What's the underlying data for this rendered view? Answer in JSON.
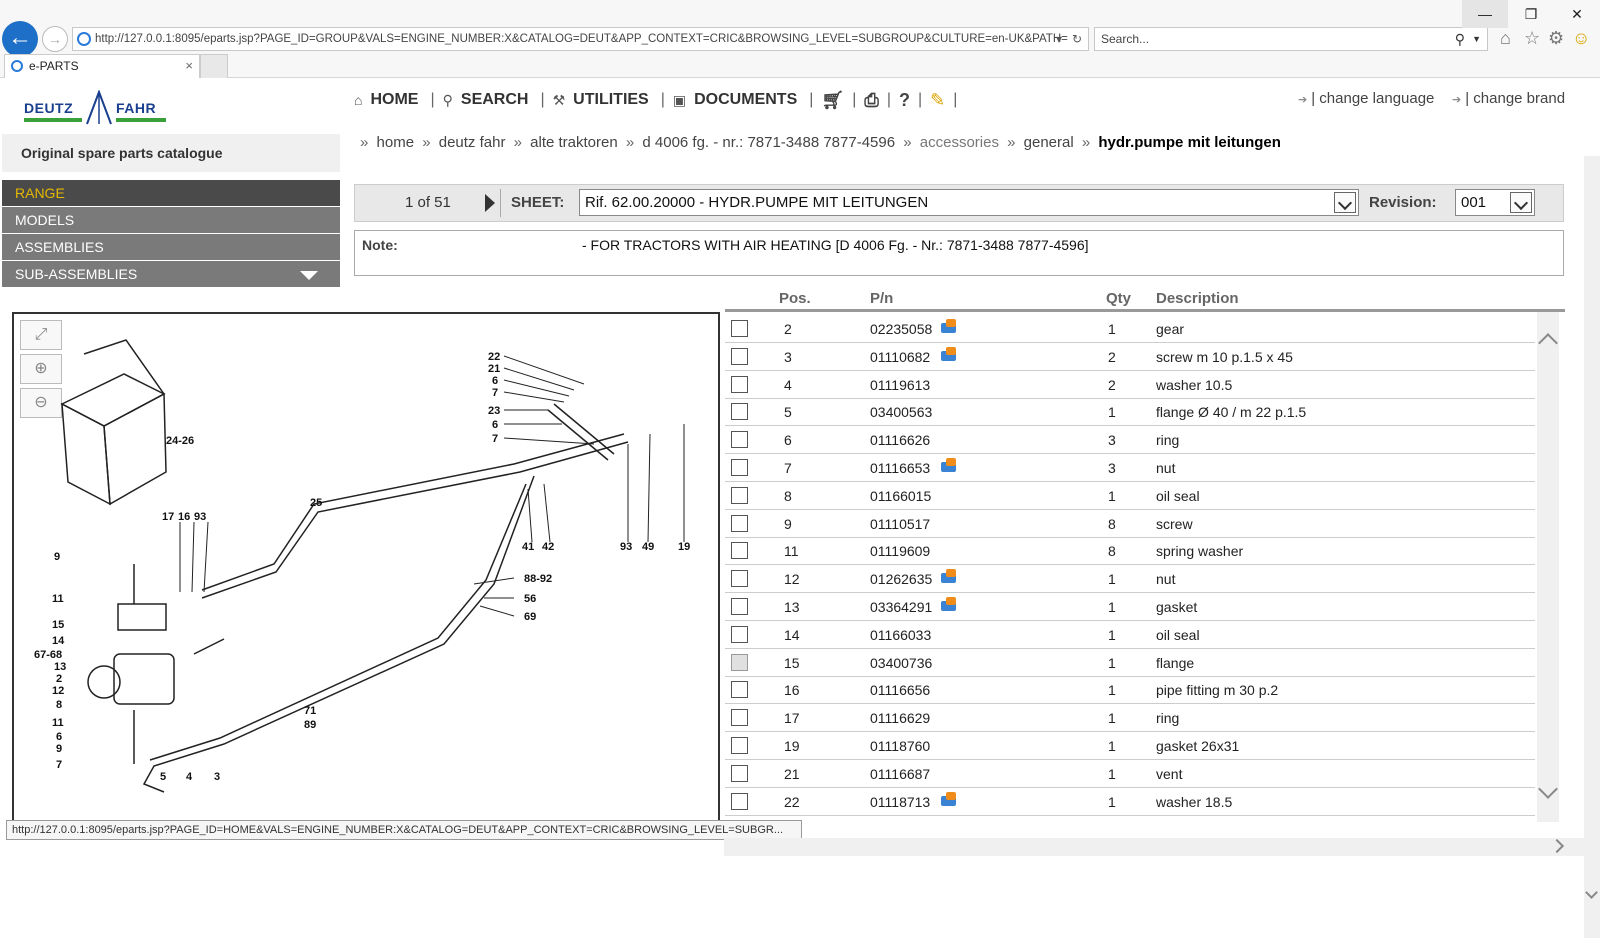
{
  "browser": {
    "url": "http://127.0.0.1:8095/eparts.jsp?PAGE_ID=GROUP&VALS=ENGINE_NUMBER:X&CATALOG=DEUT&APP_CONTEXT=CRIC&BROWSING_LEVEL=SUBGROUP&CULTURE=en-UK&PATH=",
    "search_placeholder": "Search...",
    "tab_title": "e-PARTS",
    "status_url": "http://127.0.0.1:8095/eparts.jsp?PAGE_ID=HOME&VALS=ENGINE_NUMBER:X&CATALOG=DEUT&APP_CONTEXT=CRIC&BROWSING_LEVEL=SUBGR..."
  },
  "brand": {
    "left": "DEUTZ",
    "right": "FAHR",
    "catalogue_title": "Original spare parts catalogue"
  },
  "left_menu": [
    {
      "label": "RANGE"
    },
    {
      "label": "MODELS"
    },
    {
      "label": "ASSEMBLIES"
    },
    {
      "label": "SUB-ASSEMBLIES"
    }
  ],
  "nav": {
    "home": "HOME",
    "search": "SEARCH",
    "utilities": "UTILITIES",
    "documents": "DOCUMENTS",
    "sep": "|",
    "change_language": "change language",
    "change_brand": "change brand"
  },
  "breadcrumb": {
    "sep": "»",
    "items": [
      "home",
      "deutz fahr",
      "alte traktoren",
      "d 4006 fg. - nr.: 7871-3488 7877-4596",
      "accessories",
      "general",
      "hydr.pumpe mit leitungen"
    ]
  },
  "sheet": {
    "pager": "1 of 51",
    "sheet_label": "SHEET:",
    "sheet_value": "Rif. 62.00.20000 - HYDR.PUMPE MIT LEITUNGEN",
    "revision_label": "Revision:",
    "revision_value": "001"
  },
  "note": {
    "label": "Note:",
    "text": "- FOR TRACTORS WITH AIR HEATING [D 4006 Fg. - Nr.: 7871-3488 7877-4596]"
  },
  "drawing": {
    "labels": [
      "24-26",
      "25",
      "22",
      "21",
      "6",
      "7",
      "23",
      "6",
      "7",
      "17",
      "16",
      "93",
      "9",
      "11",
      "15",
      "14",
      "67-68",
      "13",
      "2",
      "12",
      "8",
      "11",
      "6",
      "9",
      "7",
      "5",
      "4",
      "3",
      "41",
      "42",
      "93",
      "49",
      "19",
      "88-92",
      "56",
      "69",
      "71",
      "89"
    ]
  },
  "parts_table": {
    "headers": {
      "pos": "Pos.",
      "pn": "P/n",
      "qty": "Qty",
      "desc": "Description"
    },
    "rows": [
      {
        "pos": "2",
        "pn": "02235058",
        "qty": "1",
        "desc": "gear",
        "cart": true
      },
      {
        "pos": "3",
        "pn": "01110682",
        "qty": "2",
        "desc": "screw m 10 p.1.5 x 45",
        "cart": true
      },
      {
        "pos": "4",
        "pn": "01119613",
        "qty": "2",
        "desc": "washer 10.5",
        "cart": false
      },
      {
        "pos": "5",
        "pn": "03400563",
        "qty": "1",
        "desc": "flange Ø 40 / m 22 p.1.5",
        "cart": false
      },
      {
        "pos": "6",
        "pn": "01116626",
        "qty": "3",
        "desc": "ring",
        "cart": false
      },
      {
        "pos": "7",
        "pn": "01116653",
        "qty": "3",
        "desc": "nut",
        "cart": true
      },
      {
        "pos": "8",
        "pn": "01166015",
        "qty": "1",
        "desc": "oil seal",
        "cart": false
      },
      {
        "pos": "9",
        "pn": "01110517",
        "qty": "8",
        "desc": "screw",
        "cart": false
      },
      {
        "pos": "11",
        "pn": "01119609",
        "qty": "8",
        "desc": "spring washer",
        "cart": false
      },
      {
        "pos": "12",
        "pn": "01262635",
        "qty": "1",
        "desc": "nut",
        "cart": true
      },
      {
        "pos": "13",
        "pn": "03364291",
        "qty": "1",
        "desc": "gasket",
        "cart": true
      },
      {
        "pos": "14",
        "pn": "01166033",
        "qty": "1",
        "desc": "oil seal",
        "cart": false
      },
      {
        "pos": "15",
        "pn": "03400736",
        "qty": "1",
        "desc": "flange",
        "cart": false
      },
      {
        "pos": "16",
        "pn": "01116656",
        "qty": "1",
        "desc": "pipe fitting m 30 p.2",
        "cart": false
      },
      {
        "pos": "17",
        "pn": "01116629",
        "qty": "1",
        "desc": "ring",
        "cart": false
      },
      {
        "pos": "19",
        "pn": "01118760",
        "qty": "1",
        "desc": "gasket 26x31",
        "cart": false
      },
      {
        "pos": "21",
        "pn": "01116687",
        "qty": "1",
        "desc": "vent",
        "cart": false
      },
      {
        "pos": "22",
        "pn": "01118713",
        "qty": "1",
        "desc": "washer 18.5",
        "cart": true
      }
    ]
  }
}
